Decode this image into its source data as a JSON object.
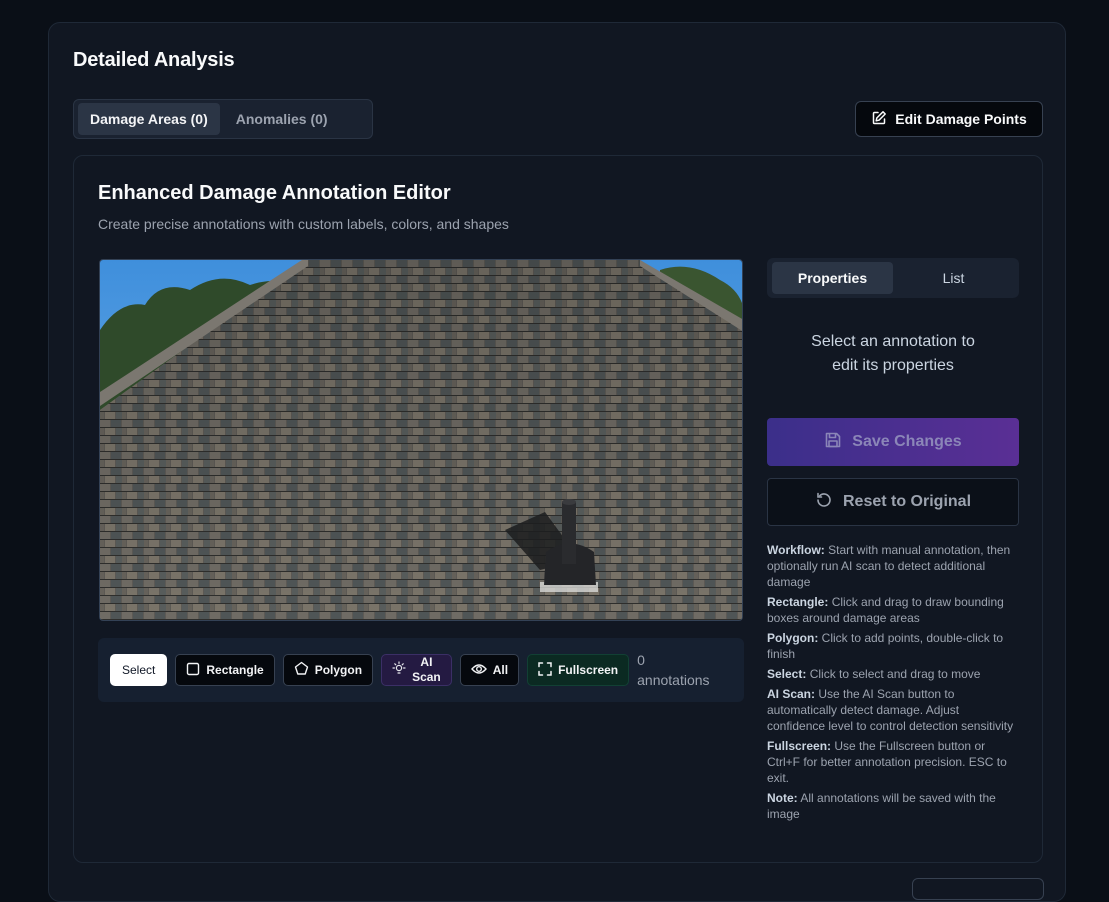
{
  "page": {
    "title": "Detailed Analysis"
  },
  "tabs": [
    {
      "label": "Damage Areas (0)",
      "active": true
    },
    {
      "label": "Anomalies (0)",
      "active": false
    }
  ],
  "edit_button": {
    "label": "Edit Damage Points",
    "icon": "edit-icon"
  },
  "editor": {
    "title": "Enhanced Damage Annotation Editor",
    "subtitle": "Create precise annotations with custom labels, colors, and shapes"
  },
  "toolbar": {
    "select": "Select",
    "rectangle": "Rectangle",
    "polygon": "Polygon",
    "ai_scan_line1": "AI",
    "ai_scan_line2": "Scan",
    "all": "All",
    "fullscreen": "Fullscreen",
    "count_line1": "0",
    "count_line2": "annotations"
  },
  "side_tabs": [
    {
      "label": "Properties",
      "active": true
    },
    {
      "label": "List",
      "active": false
    }
  ],
  "empty_message_line1": "Select an annotation to",
  "empty_message_line2": "edit its properties",
  "save_label": "Save Changes",
  "reset_label": "Reset to Original",
  "help": [
    {
      "label": "Workflow:",
      "text": " Start with manual annotation, then optionally run AI scan to detect additional damage"
    },
    {
      "label": "Rectangle:",
      "text": " Click and drag to draw bounding boxes around damage areas"
    },
    {
      "label": "Polygon:",
      "text": " Click to add points, double-click to finish"
    },
    {
      "label": "Select:",
      "text": " Click to select and drag to move"
    },
    {
      "label": "AI Scan:",
      "text": " Use the AI Scan button to automatically detect damage. Adjust confidence level to control detection sensitivity"
    },
    {
      "label": "Fullscreen:",
      "text": " Use the Fullscreen button or Ctrl+F for better annotation precision. ESC to exit."
    },
    {
      "label": "Note:",
      "text": " All annotations will be saved with the image"
    }
  ],
  "colors": {
    "background": "#0a0f17",
    "card": "#111722",
    "save_gradient_start": "#3b2f8a",
    "save_gradient_end": "#5a2f95",
    "fullscreen_bg": "#0b2a22",
    "ai_scan_bg": "#241a42"
  }
}
